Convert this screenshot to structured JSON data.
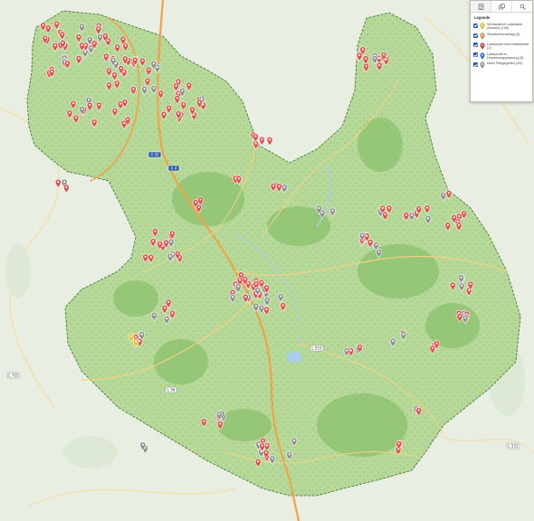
{
  "map": {
    "colors": {
      "outside": "#e9eee3",
      "region_fill": "#b6d99a",
      "region_border": "#4a7a33",
      "forest": "#8fc271",
      "motorway": "#f0a24a",
      "primary_road": "#f7d27e",
      "water": "#a9cdea"
    },
    "road_shields": [
      {
        "ref": "A 45",
        "type": "motorway"
      },
      {
        "ref": "A 4",
        "type": "motorway"
      },
      {
        "ref": "L 56",
        "type": "road"
      },
      {
        "ref": "L 553",
        "type": "road"
      },
      {
        "ref": "L 725",
        "type": "road"
      },
      {
        "ref": "L 531",
        "type": "road"
      }
    ]
  },
  "toolbar": {
    "tabs": [
      {
        "icon": "list-icon"
      },
      {
        "icon": "copy-icon"
      },
      {
        "icon": "search-icon"
      }
    ]
  },
  "legend": {
    "title": "Legende",
    "items": [
      {
        "label": "Vorhandene Ladesäule (Anzahl) (146)",
        "icon": "yellow-pin-icon",
        "color": "#e6c431",
        "checked": true
      },
      {
        "label": "Standortvorschlag (3)",
        "icon": "orange-pin-icon",
        "color": "#f08a3a",
        "checked": true
      },
      {
        "label": "Ladepunkt nicht realisierbar (1)",
        "icon": "red-pin-icon",
        "color": "#d93a3a",
        "checked": true
      },
      {
        "label": "Ladepunkt in Umsetzungsplanung (3)",
        "icon": "blue-pin-icon",
        "color": "#2f6fd6",
        "checked": true
      },
      {
        "label": "Nicht Freigegeben (45)",
        "icon": "grey-pin-icon",
        "color": "#9a9a9a",
        "checked": true
      }
    ]
  },
  "markers": {
    "red_pin_color": "#e0524a",
    "grey_pin_color": "#8f8f8f",
    "yellow_pin_color": "#e6c431"
  }
}
